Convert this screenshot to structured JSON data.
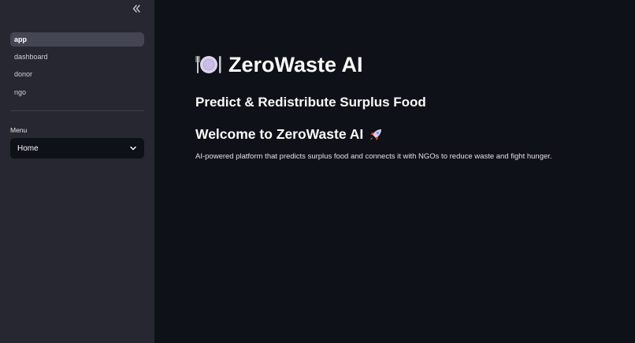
{
  "sidebar": {
    "nav_items": [
      {
        "label": "app",
        "active": true
      },
      {
        "label": "dashboard",
        "active": false
      },
      {
        "label": "donor",
        "active": false
      },
      {
        "label": "ngo",
        "active": false
      }
    ],
    "menu_label": "Menu",
    "menu_selected": "Home"
  },
  "main": {
    "title": "ZeroWaste AI",
    "subtitle": "Predict & Redistribute Surplus Food",
    "welcome_heading": "Welcome to ZeroWaste AI",
    "description": "AI-powered platform that predicts surplus food and connects it with NGOs to reduce waste and fight hunger."
  },
  "icons": {
    "collapse": "double-chevron-left-icon",
    "title": "plate-with-cutlery-icon",
    "welcome": "rocket-icon",
    "select": "chevron-down-icon"
  },
  "colors": {
    "background": "#0e1117",
    "sidebar": "#262730",
    "active_nav": "#454654",
    "text": "#fafafa"
  }
}
